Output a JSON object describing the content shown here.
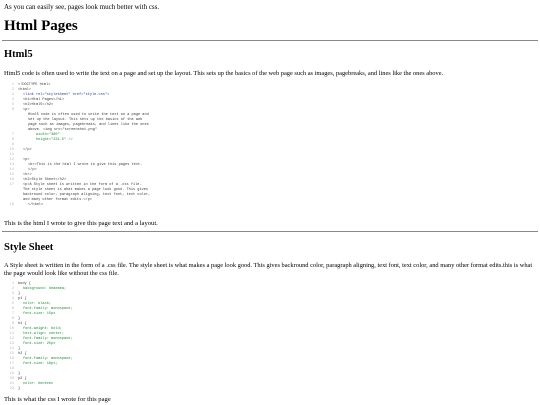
{
  "intro": "As you can easily see, pages look much better with css.",
  "page_title": "Html Pages",
  "html_section": {
    "heading": "Html5",
    "paragraph": "Html5 code is often used to write the text on a page and set up the layout. This sets up the basics of the web page such as images, pagebreaks, and lines like the ones above.",
    "code_lines": [
      {
        "n": "1",
        "t": "<!DOCTYPE html>",
        "s": "grey",
        "i": 0
      },
      {
        "n": "2",
        "t": "<html>",
        "s": "grey",
        "i": 0
      },
      {
        "n": "3",
        "t": "<link rel=\"stylesheet\" href=\"style.css\">",
        "s": "blue",
        "i": 1
      },
      {
        "n": "4",
        "t": "<h1>Html Pages</h1>",
        "s": "grey",
        "i": 1
      },
      {
        "n": "5",
        "t": "<h2>Html5</h2>",
        "s": "grey",
        "i": 1
      },
      {
        "n": "6",
        "t": "<p>",
        "s": "grey",
        "i": 1
      },
      {
        "n": "",
        "t": "Html5 code is often used to write the text on a page and",
        "s": "grey",
        "i": 2
      },
      {
        "n": "",
        "t": "set up the layout. This sets up the basics of the web",
        "s": "grey",
        "i": 2
      },
      {
        "n": "",
        "t": "page such as images, pagebreaks, and lines like the ones",
        "s": "grey",
        "i": 2
      },
      {
        "n": "",
        "t": "above. <img src=\"screenshot.png\"",
        "s": "grey",
        "i": 2
      },
      {
        "n": "7",
        "t": "width=\"380\"",
        "s": "green",
        "i": 3
      },
      {
        "n": "8",
        "t": "height=\"231.5\" />",
        "s": "green",
        "i": 3
      },
      {
        "n": "9",
        "t": "",
        "s": "grey",
        "i": 0
      },
      {
        "n": "10",
        "t": "</p>",
        "s": "grey",
        "i": 1
      },
      {
        "n": "11",
        "t": "",
        "s": "grey",
        "i": 0
      },
      {
        "n": "12",
        "t": "<p>",
        "s": "grey",
        "i": 1
      },
      {
        "n": "13",
        "t": "<br>This is the html I wrote to give this pages text.",
        "s": "grey",
        "i": 2
      },
      {
        "n": "14",
        "t": "</p>",
        "s": "grey",
        "i": 2
      },
      {
        "n": "15",
        "t": "<hr>",
        "s": "grey",
        "i": 1
      },
      {
        "n": "16",
        "t": "<h2>Style Sheet</h2>",
        "s": "grey",
        "i": 1
      },
      {
        "n": "17",
        "t": "<p>A Style sheet is written in the form of a .css file.",
        "s": "grey",
        "i": 1
      },
      {
        "n": "",
        "t": "The style sheet is what makes a page look good. This gives",
        "s": "grey",
        "i": 1
      },
      {
        "n": "",
        "t": "backround color, paragraph aligning, text font, text color,",
        "s": "grey",
        "i": 1
      },
      {
        "n": "",
        "t": "and many other format edits.</p>",
        "s": "grey",
        "i": 1
      },
      {
        "n": "18",
        "t": "</html>",
        "s": "grey",
        "i": 2
      }
    ],
    "caption": "This is the html I wrote to give this page text and a layout."
  },
  "css_section": {
    "heading": "Style Sheet",
    "paragraph": "A Style sheet is written in the form of a .css file. The style sheet is what makes a page look good. This gives backround color, paragraph aligning, text font, text color, and many other format edits.this is what the page would look like without the css file.",
    "code_lines": [
      {
        "n": "1",
        "t": "body {",
        "s": "grey",
        "i": 0
      },
      {
        "n": "2",
        "t": "background: #eaeaea;",
        "s": "green",
        "i": 1
      },
      {
        "n": "3",
        "t": "}",
        "s": "grey",
        "i": 0
      },
      {
        "n": "4",
        "t": "p1 {",
        "s": "grey",
        "i": 0
      },
      {
        "n": "5",
        "t": "color: black;",
        "s": "green",
        "i": 1
      },
      {
        "n": "6",
        "t": "font-family: monospace;",
        "s": "green",
        "i": 1
      },
      {
        "n": "7",
        "t": "font-size: 15px",
        "s": "green",
        "i": 1
      },
      {
        "n": "8",
        "t": "}",
        "s": "grey",
        "i": 0
      },
      {
        "n": "9",
        "t": "h1 {",
        "s": "grey",
        "i": 0
      },
      {
        "n": "10",
        "t": "font-weight: bold;",
        "s": "green",
        "i": 1
      },
      {
        "n": "11",
        "t": "text-align: center;",
        "s": "green",
        "i": 1
      },
      {
        "n": "12",
        "t": "font-family: monospace;",
        "s": "green",
        "i": 1
      },
      {
        "n": "13",
        "t": "font-size: 25px",
        "s": "green",
        "i": 1
      },
      {
        "n": "14",
        "t": "}",
        "s": "grey",
        "i": 0
      },
      {
        "n": "15",
        "t": "h2 {",
        "s": "grey",
        "i": 0
      },
      {
        "n": "16",
        "t": "font-family: monospace;",
        "s": "green",
        "i": 1
      },
      {
        "n": "17",
        "t": "font-size: 18px;",
        "s": "green",
        "i": 1
      },
      {
        "n": "18",
        "t": "",
        "s": "grey",
        "i": 0
      },
      {
        "n": "19",
        "t": "}",
        "s": "grey",
        "i": 0
      },
      {
        "n": "20",
        "t": "p2 {",
        "s": "grey",
        "i": 0
      },
      {
        "n": "21",
        "t": "color: #ececec",
        "s": "green",
        "i": 1
      },
      {
        "n": "22",
        "t": "}",
        "s": "grey",
        "i": 0
      }
    ],
    "caption": "This is what the css I wrote for this page"
  }
}
